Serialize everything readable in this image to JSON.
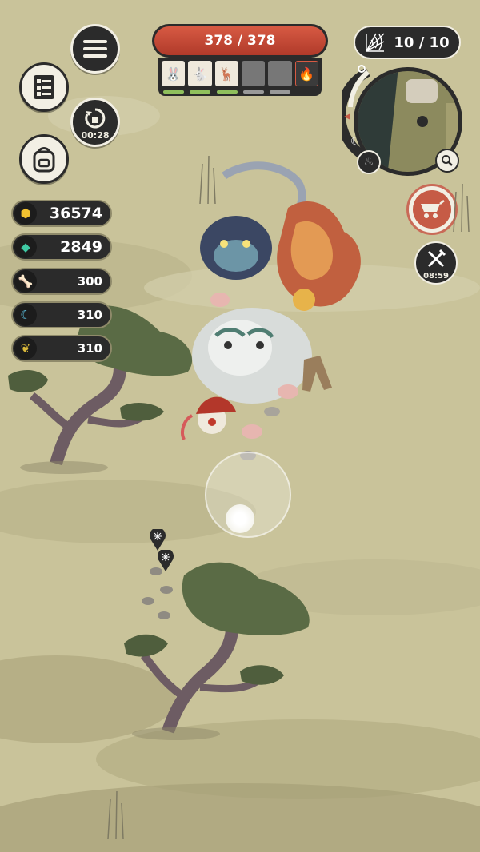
{
  "hp": {
    "text": "378 / 378",
    "current": 378,
    "max": 378
  },
  "party": {
    "slots": [
      {
        "kind": "rabbit",
        "icon": "rabbit-icon",
        "glyph": "🐰",
        "filled": true
      },
      {
        "kind": "rabbit",
        "icon": "rabbit-icon",
        "glyph": "🐇",
        "filled": true
      },
      {
        "kind": "deer",
        "icon": "deer-icon",
        "glyph": "🦌",
        "filled": true
      },
      {
        "kind": "empty",
        "icon": "",
        "glyph": "",
        "filled": false
      },
      {
        "kind": "empty",
        "icon": "",
        "glyph": "",
        "filled": false
      },
      {
        "kind": "fire",
        "icon": "fire-potion-icon",
        "glyph": "🔥",
        "filled": true
      }
    ]
  },
  "counter": {
    "icon": "web-icon",
    "text": "10 / 10"
  },
  "left_buttons": {
    "menu": {
      "icon": "hamburger-menu-icon"
    },
    "quests": {
      "icon": "quest-checklist-icon"
    },
    "respawn": {
      "icon": "return-icon",
      "timer": "00:28"
    },
    "backpack": {
      "icon": "backpack-icon"
    }
  },
  "resources": [
    {
      "name": "gold",
      "icon": "gold-nugget-icon",
      "glyph": "⬢",
      "color": "#f2c230",
      "value": "36574"
    },
    {
      "name": "gem",
      "icon": "gem-icon",
      "glyph": "◆",
      "color": "#3fc9a4",
      "value": "2849"
    },
    {
      "name": "bone",
      "icon": "bone-icon",
      "glyph": "🦴",
      "color": "#e8968e",
      "value": "300"
    },
    {
      "name": "claw",
      "icon": "claw-icon",
      "glyph": "☾",
      "color": "#5fc8e8",
      "value": "310"
    },
    {
      "name": "feather",
      "icon": "feather-icon",
      "glyph": "❦",
      "color": "#d9b83a",
      "value": "310"
    }
  ],
  "minimap": {
    "sun_icon": "sun-icon",
    "moon_icon": "moon-icon",
    "fire_icon": "flame-icon",
    "zoom_icon": "magnifier-icon"
  },
  "right_buttons": {
    "cart": {
      "icon": "cart-icon",
      "color": "#c65b46"
    },
    "skill": {
      "icon": "crossed-weapons-icon",
      "timer": "08:59"
    }
  },
  "markers": [
    {
      "icon": "web-marker-icon"
    },
    {
      "icon": "web-marker-icon"
    }
  ]
}
